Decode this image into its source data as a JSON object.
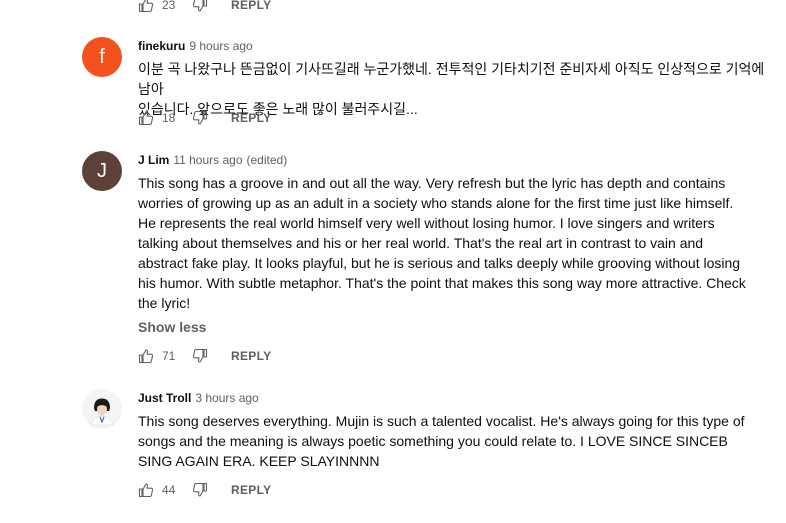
{
  "top_actions": {
    "like_count": "23",
    "reply_label": "REPLY"
  },
  "comments": [
    {
      "author": "finekuru",
      "time": "9 hours ago",
      "edited": "",
      "avatar_letter": "f",
      "avatar_color": "#f4511e",
      "text": "이분 곡 나왔구나 뜬금없이 기사뜨길래 누군가했네. 전투적인 기타치기전 준비자세 아직도 인상적으로 기억에 남아\n있습니다. 앞으로도 좋은 노래 많이 불러주시길...",
      "like_count": "18",
      "reply_label": "REPLY"
    },
    {
      "author": "J Lim",
      "time": "11 hours ago",
      "edited": "(edited)",
      "avatar_letter": "J",
      "avatar_color": "#5d4037",
      "text": "This song has a groove in and out all the way. Very refresh but the lyric has depth and contains\nworries of growing up as an adult in a society who stands alone for the first time just like himself.\nHe represents the real world himself very well without losing humor. I love singers and writers\ntalking about themselves and his or her real world. That's the real art in contrast to vain and\nabstract fake play. It looks playful, but he is serious and talks deeply while grooving without losing\nhis humor. With subtle metaphor. That's the point that makes this song way more attractive. Check\nthe lyric!",
      "show_less": "Show less",
      "like_count": "71",
      "reply_label": "REPLY"
    },
    {
      "author": "Just Troll",
      "time": "3 hours ago",
      "edited": "",
      "text": "This song deserves everything. Mujin is such a talented vocalist. He's always going for this type of\nsongs and the meaning is always poetic something you could relate to. I LOVE SINCE SINCEB\nSING AGAIN ERA. KEEP SLAYINNNN",
      "like_count": "44",
      "reply_label": "REPLY"
    }
  ]
}
